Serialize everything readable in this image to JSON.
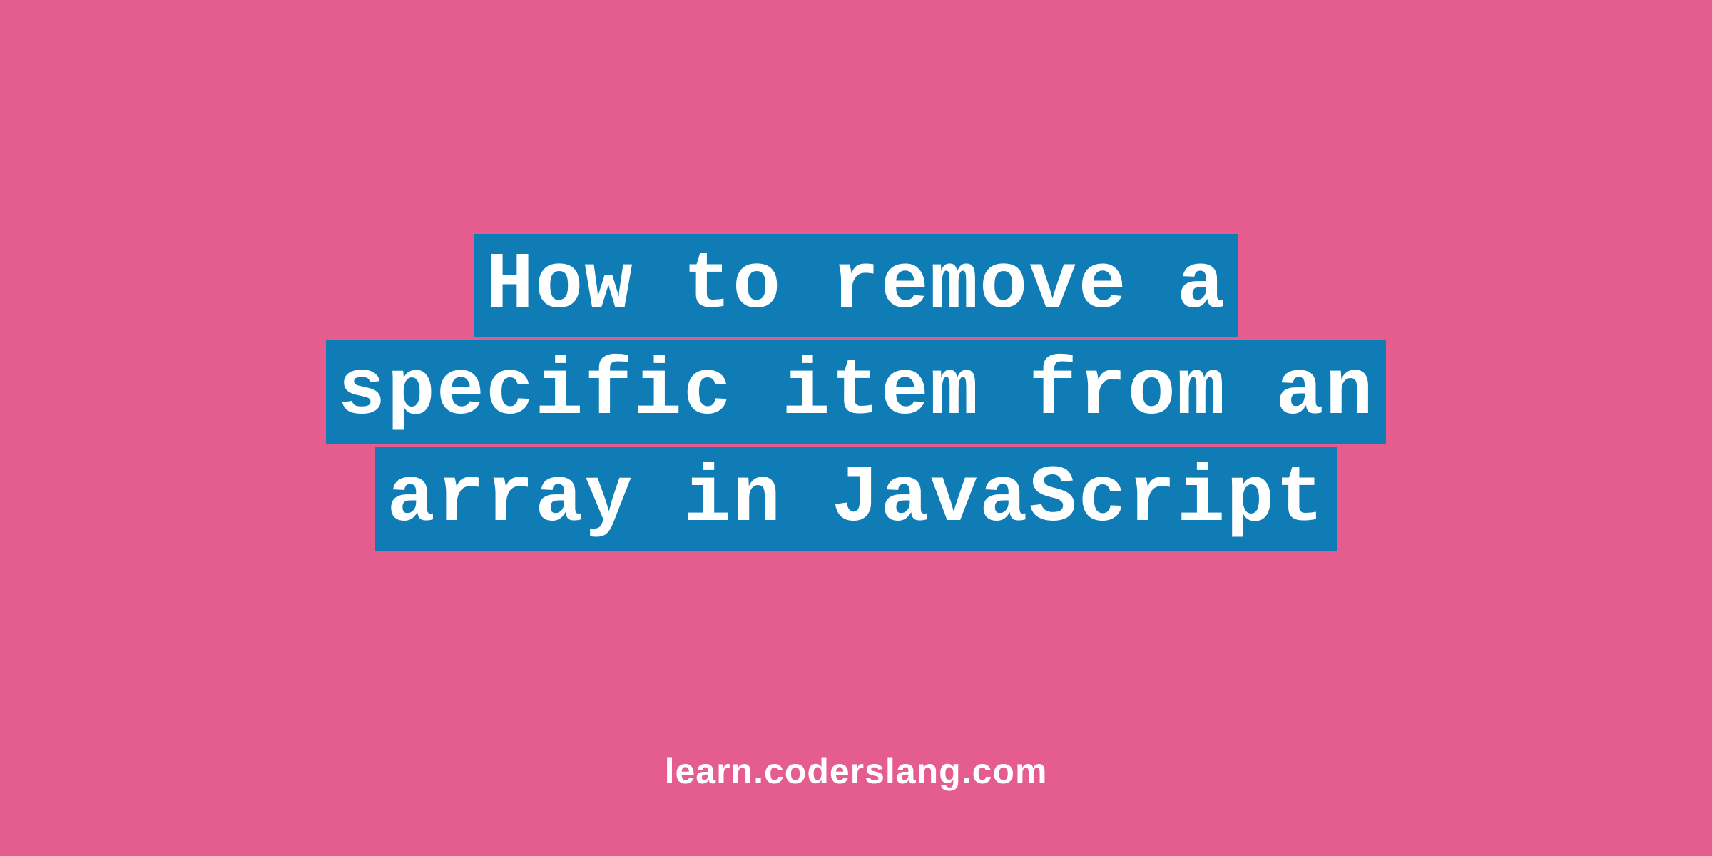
{
  "title": {
    "line1": "How to remove a",
    "line2": "specific item from an",
    "line3": "array in JavaScript"
  },
  "footer": {
    "text": "learn.coderslang.com"
  },
  "colors": {
    "background": "#e45d8e",
    "highlight": "#0f7cb5",
    "text": "#ffffff"
  }
}
